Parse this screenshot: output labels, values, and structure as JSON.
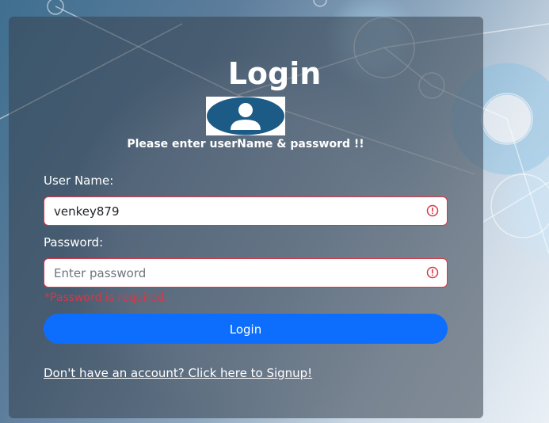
{
  "login": {
    "title": "Login",
    "subtitle": "Please enter userName & password !!",
    "username": {
      "label": "User Name:",
      "value": "venkey879",
      "placeholder": ""
    },
    "password": {
      "label": "Password:",
      "value": "",
      "placeholder": "Enter password",
      "error": "*Password is required."
    },
    "submit_label": "Login",
    "signup_link": "Don't have an account? Click here to Signup!"
  },
  "icons": {
    "avatar": "user-avatar-icon",
    "error": "error-icon"
  },
  "colors": {
    "primary": "#0d6efd",
    "error": "#dc3545",
    "avatar_bg": "#1b5b86"
  }
}
